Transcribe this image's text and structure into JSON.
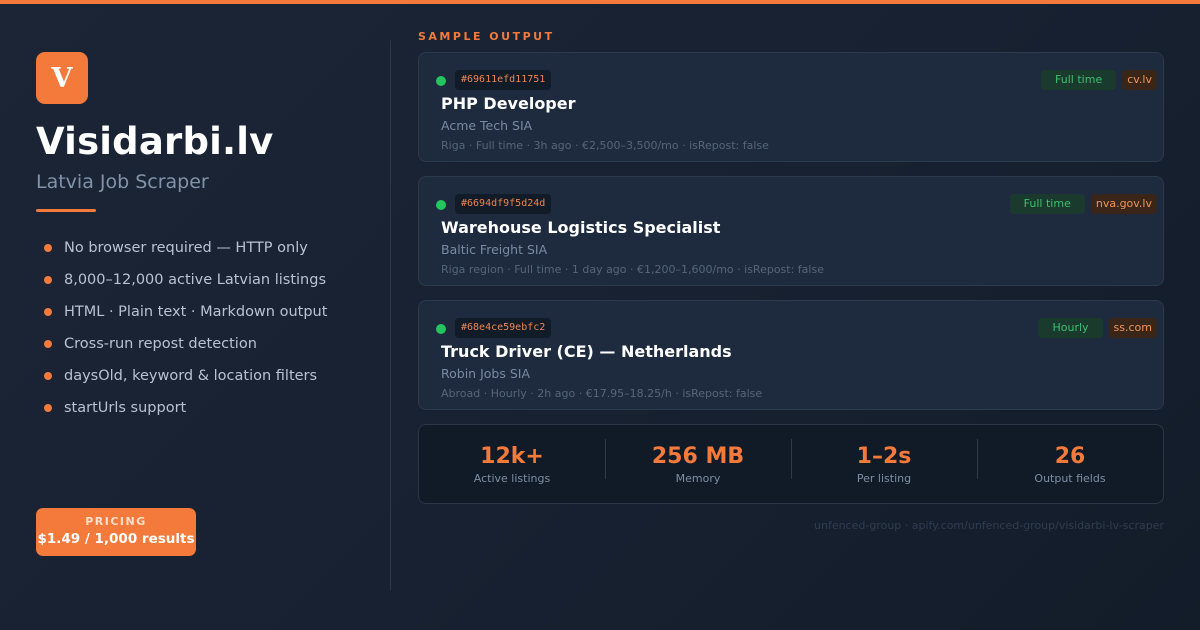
{
  "colors": {
    "accent": "#f47a3b",
    "status_active": "#22c55e",
    "background": "#172131"
  },
  "brand": {
    "logo_letter": "V",
    "title": "Visidarbi.lv",
    "subtitle": "Latvia Job Scraper"
  },
  "features": [
    "No browser required — HTTP only",
    "8,000–12,000 active Latvian listings",
    "HTML · Plain text · Markdown output",
    "Cross-run repost detection",
    "daysOld, keyword & location filters",
    "startUrls support"
  ],
  "pricing": {
    "label": "PRICING",
    "value": "$1.49 / 1,000 results"
  },
  "sample": {
    "label": "SAMPLE OUTPUT",
    "jobs": [
      {
        "id": "#69611efd11751",
        "title": "PHP Developer",
        "company": "Acme Tech SIA",
        "meta": "Riga · Full time · 3h ago · €2,500–3,500/mo · isRepost: false",
        "type": "Full time",
        "source": "cv.lv"
      },
      {
        "id": "#6694df9f5d24d",
        "title": "Warehouse Logistics Specialist",
        "company": "Baltic Freight SIA",
        "meta": "Riga region · Full time · 1 day ago · €1,200–1,600/mo · isRepost: false",
        "type": "Full time",
        "source": "nva.gov.lv"
      },
      {
        "id": "#68e4ce59ebfc2",
        "title": "Truck Driver (CE) — Netherlands",
        "company": "Robin Jobs SIA",
        "meta": "Abroad · Hourly · 2h ago · €17.95–18.25/h · isRepost: false",
        "type": "Hourly",
        "source": "ss.com"
      }
    ]
  },
  "stats": [
    {
      "value": "12k+",
      "label": "Active listings"
    },
    {
      "value": "256 MB",
      "label": "Memory"
    },
    {
      "value": "1–2s",
      "label": "Per listing"
    },
    {
      "value": "26",
      "label": "Output fields"
    }
  ],
  "footer": "unfenced-group · apify.com/unfenced-group/visidarbi-lv-scraper"
}
